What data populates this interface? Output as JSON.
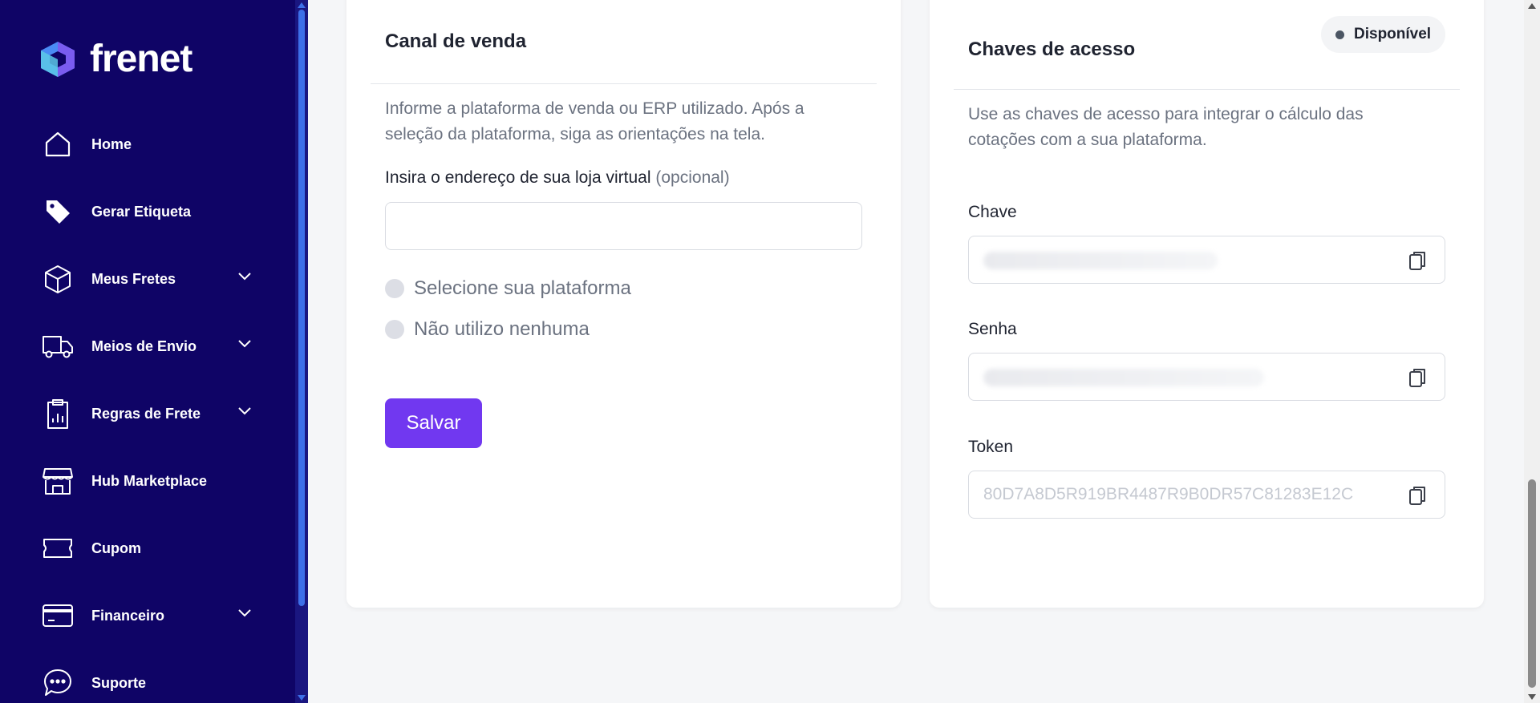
{
  "brand": {
    "name": "frenet",
    "logo_icon": "hexagon-logo-icon"
  },
  "sidebar": {
    "items": [
      {
        "label": "Home",
        "icon": "home-icon",
        "has_submenu": false
      },
      {
        "label": "Gerar Etiqueta",
        "icon": "tag-icon",
        "has_submenu": false
      },
      {
        "label": "Meus Fretes",
        "icon": "box-icon",
        "has_submenu": true
      },
      {
        "label": "Meios de Envio",
        "icon": "truck-icon",
        "has_submenu": true
      },
      {
        "label": "Regras de Frete",
        "icon": "clipboard-chart-icon",
        "has_submenu": true
      },
      {
        "label": "Hub Marketplace",
        "icon": "store-icon",
        "has_submenu": false
      },
      {
        "label": "Cupom",
        "icon": "ticket-icon",
        "has_submenu": false
      },
      {
        "label": "Financeiro",
        "icon": "credit-card-icon",
        "has_submenu": true
      },
      {
        "label": "Suporte",
        "icon": "chat-icon",
        "has_submenu": false
      }
    ]
  },
  "sales_channel": {
    "title": "Canal de venda",
    "description": "Informe a plataforma de venda ou ERP utilizado. Após a seleção da plataforma, siga as orientações na tela.",
    "store_url_label": "Insira o endereço de sua loja virtual",
    "store_url_optional": "(opcional)",
    "store_url_value": "",
    "options": [
      {
        "label": "Selecione sua plataforma",
        "selected": false
      },
      {
        "label": "Não utilizo nenhuma",
        "selected": false
      }
    ],
    "save_label": "Salvar"
  },
  "access_keys": {
    "title": "Chaves de acesso",
    "status": "Disponível",
    "description": "Use as chaves de acesso para integrar o cálculo das cotações com a sua plataforma.",
    "key_label": "Chave",
    "password_label": "Senha",
    "token_label": "Token",
    "token_value": "80D7A8D5R919BR4487R9B0DR57C81283E12C"
  },
  "colors": {
    "sidebar_bg": "#0f0466",
    "accent": "#7138f0",
    "scroll_accent": "#3d6fe8"
  }
}
